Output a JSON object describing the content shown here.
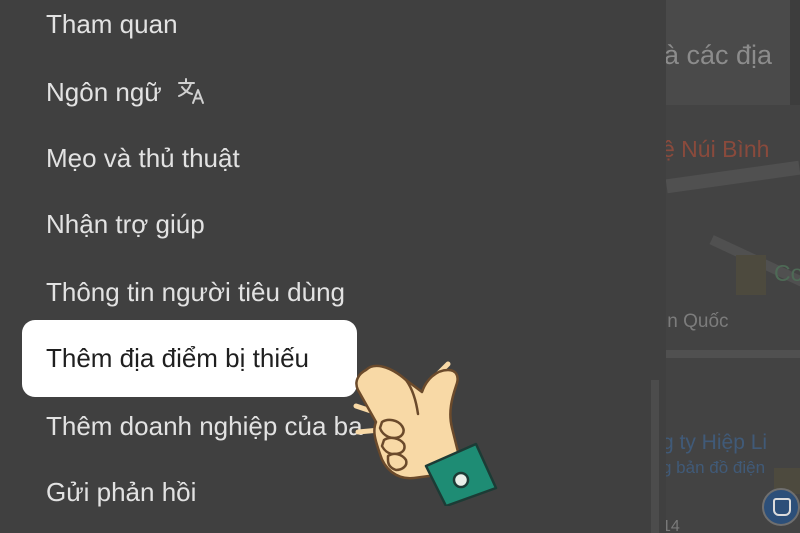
{
  "map": {
    "search_text": "à các địa",
    "poi_labels": [
      "ệ Núi Bình",
      "Co",
      "ìn Quốc",
      "g ty Hiệp Li",
      "g bản đồ điện",
      "14"
    ]
  },
  "menu": {
    "items": [
      {
        "label": "Tham quan"
      },
      {
        "label": "Ngôn ngữ",
        "icon": "translate-icon"
      },
      {
        "label": "Mẹo và thủ thuật"
      },
      {
        "label": "Nhận trợ giúp"
      },
      {
        "label": "Thông tin người tiêu dùng"
      },
      {
        "label": "Thêm địa điểm bị thiếu",
        "highlighted": true
      },
      {
        "label": "Thêm doanh nghiệp của ba"
      },
      {
        "label": "Gửi phản hồi"
      }
    ]
  },
  "pointer": {
    "icon": "pointing-hand-icon"
  },
  "colors": {
    "overlay": "#404040",
    "highlight": "#ffffff",
    "menu_text": "#e2e2e2",
    "cuff": "#1e8c74",
    "hand_skin": "#f8d9a6"
  }
}
